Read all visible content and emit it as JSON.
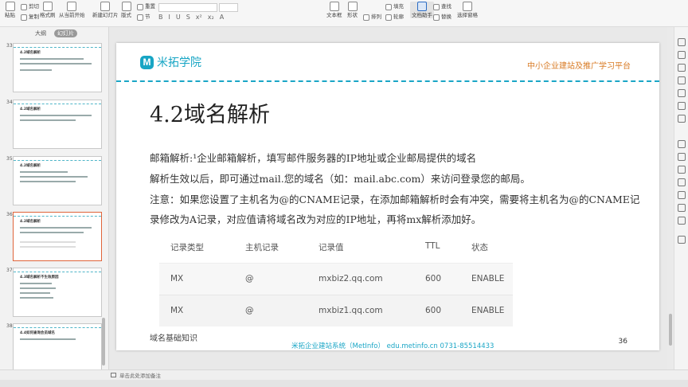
{
  "toolbar": {
    "paste": "粘贴",
    "cut": "剪切",
    "copy": "复制",
    "format_painter": "格式刷",
    "from_current": "从当前开始",
    "new_slide": "新建幻灯片",
    "layout": "版式",
    "section": "节",
    "reset": "重置",
    "textbox": "文本框",
    "shape": "形状",
    "arrange": "排列",
    "outline": "轮廓",
    "format_text": "文档助手",
    "find": "查找",
    "replace": "替换",
    "select_pane": "选择窗格",
    "fill": "填充"
  },
  "left_panel": {
    "tab_outline": "大纲",
    "tab_slides": "幻灯片",
    "add_slide": "+",
    "slides": [
      {
        "num": "33",
        "title": "4.2域名解析"
      },
      {
        "num": "34",
        "title": "4.2域名解析"
      },
      {
        "num": "35",
        "title": "4.2域名解析"
      },
      {
        "num": "36",
        "title": "4.2域名解析"
      },
      {
        "num": "37",
        "title": "4.3域名解析不生效原因"
      },
      {
        "num": "38",
        "title": "4.4如何查询会员域名"
      }
    ]
  },
  "slide": {
    "logo_letter": "M",
    "logo_text": "米拓学院",
    "platform": "中小企业建站及推广学习平台",
    "title": "4.2域名解析",
    "body": [
      "邮箱解析:¹企业邮箱解析，填写邮件服务器的IP地址或企业邮局提供的域名",
      "解析生效以后，即可通过mail.您的域名（如：mail.abc.com）来访问登录您的邮局。",
      "注意：如果您设置了主机名为@的CNAME记录，在添加邮箱解析时会有冲突，需要将主机名为@的CNAME记",
      "录修改为A记录，对应值请将域名改为对应的IP地址，再将mx解析添加好。"
    ],
    "table": {
      "headers": [
        "记录类型",
        "主机记录",
        "记录值",
        "TTL",
        "状态"
      ],
      "rows": [
        [
          "MX",
          "@",
          "mxbiz2.qq.com",
          "600",
          "ENABLE"
        ],
        [
          "MX",
          "@",
          "mxbiz1.qq.com",
          "600",
          "ENABLE"
        ]
      ]
    },
    "footer_left": "域名基础知识",
    "footer_center": "米拓企业建站系统（MetInfo） edu.metinfo.cn 0731-85514433",
    "page_number": "36"
  },
  "notes": {
    "placeholder": "单击此处添加备注"
  },
  "colors": {
    "brand": "#17a5c4",
    "platform": "#d87a23",
    "active_thumb": "#e0643a"
  }
}
